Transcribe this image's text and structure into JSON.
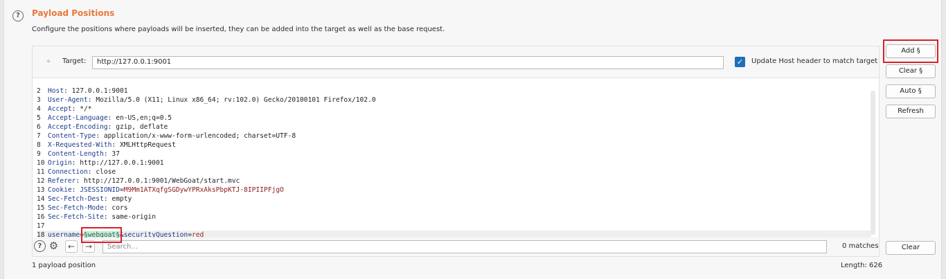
{
  "section": {
    "title": "Payload Positions",
    "description": "Configure the positions where payloads will be inserted, they can be added into the target as well as the base request."
  },
  "target": {
    "label": "Target:",
    "value": "http://127.0.0.1:9001",
    "update_host_label": "Update Host header to match target",
    "update_host_checked": true
  },
  "request_lines": [
    {
      "num": "2",
      "key": "Host",
      "value": " 127.0.0.1:9001"
    },
    {
      "num": "3",
      "key": "User-Agent",
      "value": " Mozilla/5.0 (X11; Linux x86_64; rv:102.0) Gecko/20100101 Firefox/102.0"
    },
    {
      "num": "4",
      "key": "Accept",
      "value": " */*"
    },
    {
      "num": "5",
      "key": "Accept-Language",
      "value": " en-US,en;q=0.5"
    },
    {
      "num": "6",
      "key": "Accept-Encoding",
      "value": " gzip, deflate"
    },
    {
      "num": "7",
      "key": "Content-Type",
      "value": " application/x-www-form-urlencoded; charset=UTF-8"
    },
    {
      "num": "8",
      "key": "X-Requested-With",
      "value": " XMLHttpRequest"
    },
    {
      "num": "9",
      "key": "Content-Length",
      "value": " 37"
    },
    {
      "num": "10",
      "key": "Origin",
      "value": " http://127.0.0.1:9001"
    },
    {
      "num": "11",
      "key": "Connection",
      "value": " close"
    },
    {
      "num": "12",
      "key": "Referer",
      "value": " http://127.0.0.1:9001/WebGoat/start.mvc"
    },
    {
      "num": "13",
      "key": "Cookie",
      "value": " ",
      "cookie_name": "JSESSIONID",
      "cookie_value": "M9Mm1ATXqfgSGDywYPRxAksPbpKTJ-8IPIIPFjgO"
    },
    {
      "num": "14",
      "key": "Sec-Fetch-Dest",
      "value": " empty"
    },
    {
      "num": "15",
      "key": "Sec-Fetch-Mode",
      "value": " cors"
    },
    {
      "num": "16",
      "key": "Sec-Fetch-Site",
      "value": " same-origin"
    },
    {
      "num": "17",
      "key": "",
      "value": ""
    }
  ],
  "body_line": {
    "num": "18",
    "param1": "username",
    "payload": "§webgoat§",
    "amp_param2": "&securityQuestion",
    "value2": "red"
  },
  "search": {
    "placeholder": "Search...",
    "matches": "0 matches"
  },
  "buttons": {
    "add": "Add §",
    "clear_marker": "Clear §",
    "auto": "Auto §",
    "refresh": "Refresh",
    "clear": "Clear"
  },
  "footer": {
    "positions": "1 payload position",
    "length": "Length: 626"
  },
  "icons": {
    "help": "help-circle-icon",
    "crosshair": "crosshair-icon",
    "gear": "gear-icon",
    "back": "arrow-left-icon",
    "forward": "arrow-right-icon"
  },
  "colors": {
    "accent": "#e8793a",
    "highlight": "#d8202b",
    "checkbox": "#1e6fb8"
  }
}
